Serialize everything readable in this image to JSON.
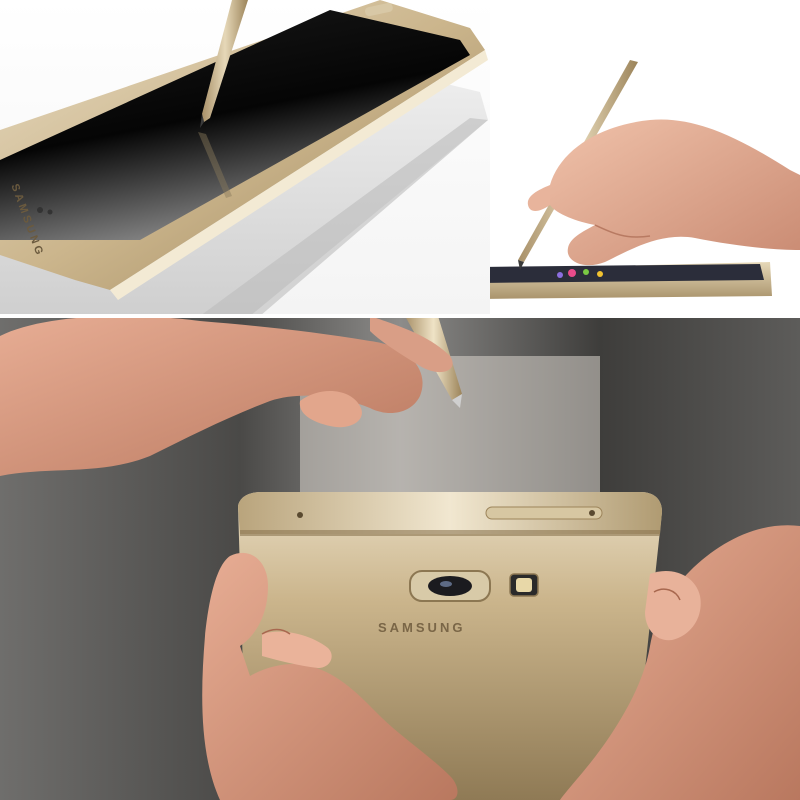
{
  "image": {
    "brand_on_phone_front": "SAMSUNG",
    "brand_on_phone_back": "SAMSUNG",
    "colors": {
      "gold_frame": "#cbb58c",
      "gold_light": "#e8dcc2",
      "gold_dark": "#9c845a",
      "screen_black": "#0a0a0a",
      "skin": "#d9a48b",
      "background_dark": "#5b5a58"
    },
    "scenes": {
      "top_left": "phone-with-stylus-on-glass",
      "top_right": "hand-writing-on-phone-with-stylus",
      "bottom": "hands-holding-phone-back-and-stylus"
    }
  }
}
